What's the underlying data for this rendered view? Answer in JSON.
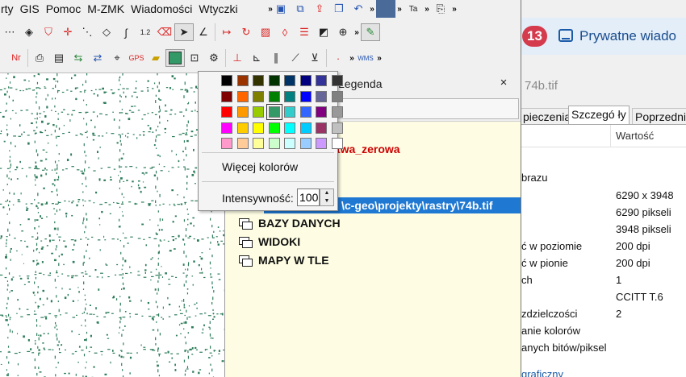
{
  "app": {
    "menu": [
      "rty",
      "GIS",
      "Pomoc",
      "M-ZMK",
      "Wiadomości",
      "Wtyczki"
    ]
  },
  "legend": {
    "title": "Legenda",
    "close": "×",
    "layer_red": "twa_zerowa",
    "selected_path": "\\c-geo\\projekty\\rastry\\74b.tif",
    "items": [
      "BAZY DANYCH",
      "WIDOKI",
      "MAPY W TLE"
    ]
  },
  "popup": {
    "swatches": [
      "#000000",
      "#993300",
      "#333300",
      "#003300",
      "#003366",
      "#000080",
      "#333399",
      "#333333",
      "#800000",
      "#ff6600",
      "#808000",
      "#008000",
      "#008080",
      "#0000ff",
      "#666699",
      "#808080",
      "#ff0000",
      "#ff9900",
      "#99cc00",
      "#339966",
      "#33cccc",
      "#3366ff",
      "#800080",
      "#999999",
      "#ff00ff",
      "#ffcc00",
      "#ffff00",
      "#00ff00",
      "#00ffff",
      "#00ccff",
      "#993366",
      "#c0c0c0",
      "#ff99cc",
      "#ffcc99",
      "#ffff99",
      "#ccffcc",
      "#ccffff",
      "#99ccff",
      "#cc99ff",
      "#ffffff"
    ],
    "selected_index": 19,
    "more_colors": "Więcej kolorów",
    "intensity_label": "Intensywność:",
    "intensity_value": "100"
  },
  "right": {
    "badge": "13",
    "folder_label": "Prywatne wiado",
    "file_title": "74b.tif",
    "tabs": [
      "pieczenia",
      "Szczegó ły",
      "Poprzedni"
    ],
    "column_value": "Wartość",
    "rows": [
      {
        "name": "brazu",
        "value": ""
      },
      {
        "name": "",
        "value": "6290 x 3948"
      },
      {
        "name": "",
        "value": "6290 pikseli"
      },
      {
        "name": "",
        "value": "3948 pikseli"
      },
      {
        "name": "ć w poziomie",
        "value": "200 dpi"
      },
      {
        "name": "ć w pionie",
        "value": "200 dpi"
      },
      {
        "name": "ch",
        "value": "1"
      },
      {
        "name": "",
        "value": "CCITT T.6"
      },
      {
        "name": "zdzielczości",
        "value": "2"
      },
      {
        "name": "anie kolorów",
        "value": ""
      },
      {
        "name": "anych bitów/piksel",
        "value": ""
      }
    ],
    "bottom_blue": "graficzny"
  },
  "colors": {
    "map_green": "#2e7d5b",
    "legend_bg": "#fefde3",
    "selection": "#1f78d1"
  }
}
